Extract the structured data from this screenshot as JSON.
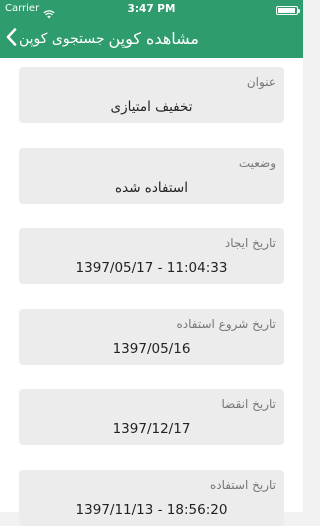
{
  "status_bar": {
    "carrier": "Carrier",
    "time": "3:47 PM"
  },
  "navbar": {
    "back_label": "جستجوی کوپن",
    "title": "مشاهده کوپن"
  },
  "fields": [
    {
      "label": "عنوان",
      "value": "تخفیف امتیازی"
    },
    {
      "label": "وضعیت",
      "value": "استفاده شده"
    },
    {
      "label": "تاریخ ایجاد",
      "value": "1397/05/17 - 11:04:33"
    },
    {
      "label": "تاریخ شروع استفاده",
      "value": "1397/05/16"
    },
    {
      "label": "تاریخ انقضا",
      "value": "1397/12/17"
    },
    {
      "label": "تاریخ استفاده",
      "value": "1397/11/13 - 18:56:20"
    }
  ],
  "colors": {
    "accent": "#2e9c6c",
    "card_bg": "#ececec"
  }
}
